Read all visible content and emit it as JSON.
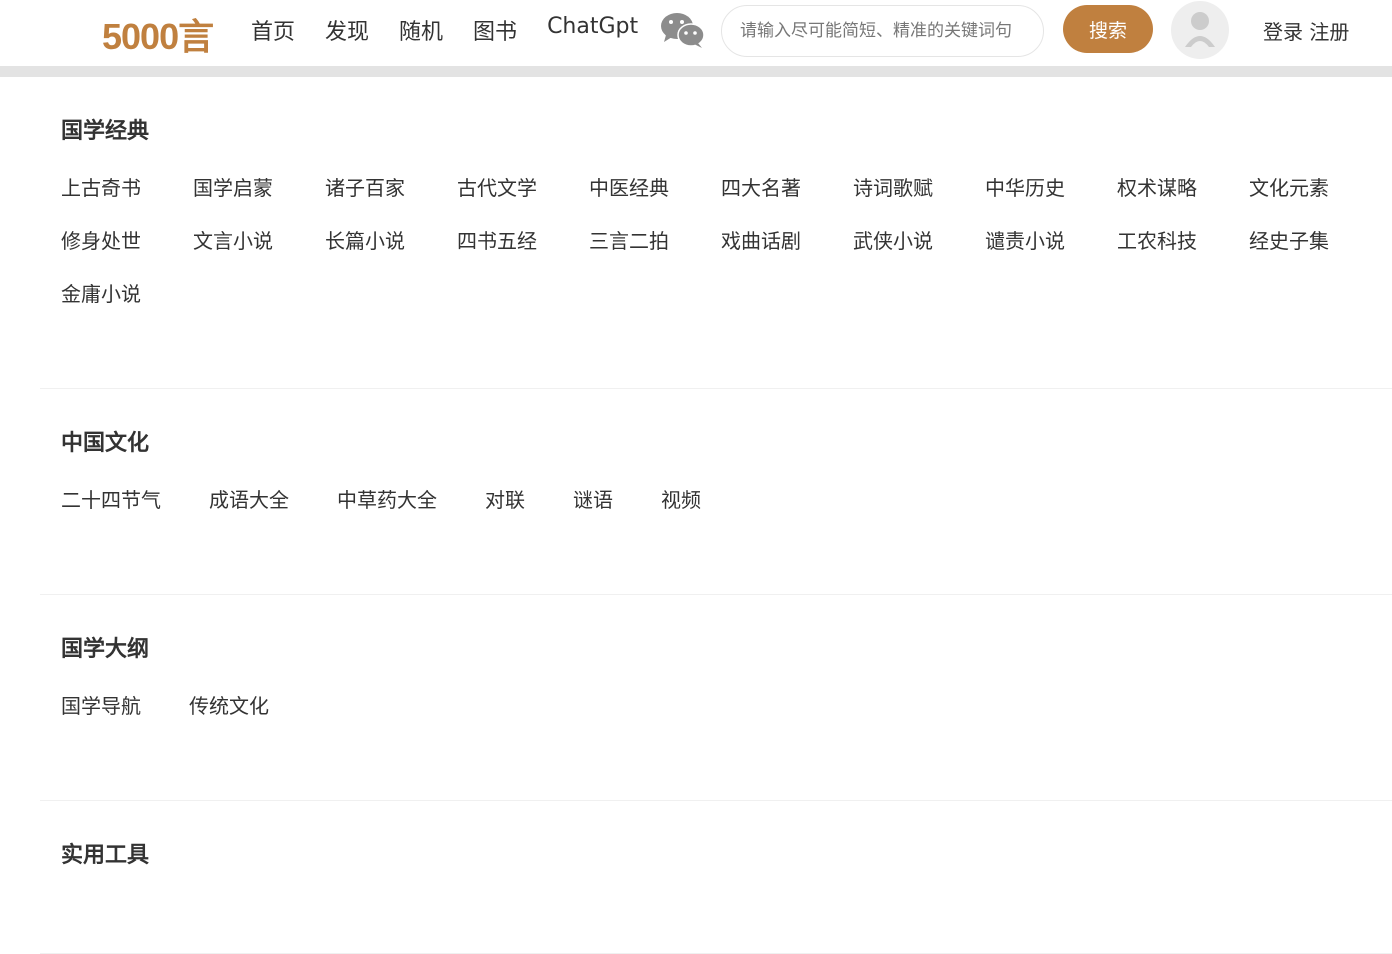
{
  "header": {
    "logo": "5000言",
    "nav": [
      "首页",
      "发现",
      "随机",
      "图书",
      "ChatGpt"
    ],
    "search_placeholder": "请输入尽可能简短、精准的关键词句",
    "search_button": "搜索",
    "login": "登录",
    "register": "注册",
    "accent": "#c0803f"
  },
  "sections": [
    {
      "title": "国学经典",
      "items": [
        "上古奇书",
        "国学启蒙",
        "诸子百家",
        "古代文学",
        "中医经典",
        "四大名著",
        "诗词歌赋",
        "中华历史",
        "权术谋略",
        "文化元素",
        "修身处世",
        "文言小说",
        "长篇小说",
        "四书五经",
        "三言二拍",
        "戏曲话剧",
        "武侠小说",
        "谴责小说",
        "工农科技",
        "经史子集",
        "金庸小说"
      ]
    },
    {
      "title": "中国文化",
      "items": [
        "二十四节气",
        "成语大全",
        "中草药大全",
        "对联",
        "谜语",
        "视频"
      ]
    },
    {
      "title": "国学大纲",
      "items": [
        "国学导航",
        "传统文化"
      ]
    },
    {
      "title": "实用工具",
      "items": []
    }
  ]
}
